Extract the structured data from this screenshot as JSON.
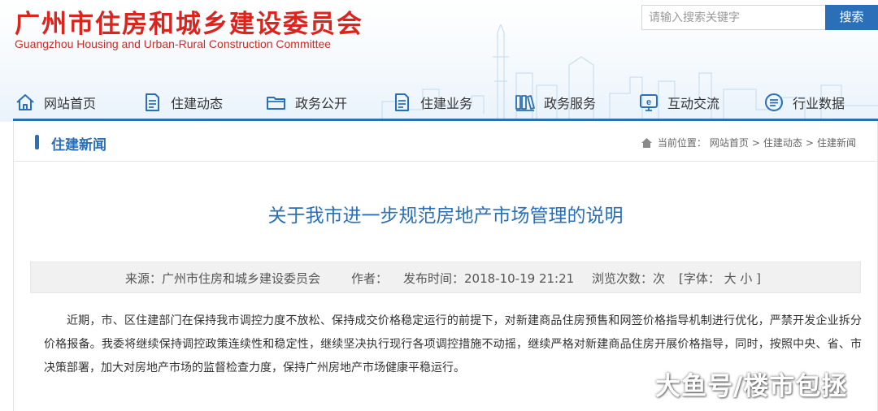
{
  "header": {
    "title": "广州市住房和城乡建设委员会",
    "subtitle": "Guangzhou Housing and Urban-Rural Construction Committee"
  },
  "search": {
    "placeholder": "请输入搜索关键字",
    "button_label": "搜索"
  },
  "nav": {
    "items": [
      {
        "label": "网站首页",
        "icon": "home-icon"
      },
      {
        "label": "住建动态",
        "icon": "document-icon"
      },
      {
        "label": "政务公开",
        "icon": "folder-icon"
      },
      {
        "label": "住建业务",
        "icon": "document-icon"
      },
      {
        "label": "政务服务",
        "icon": "books-icon"
      },
      {
        "label": "互动交流",
        "icon": "chat-screen-icon"
      },
      {
        "label": "行业数据",
        "icon": "list-circle-icon"
      }
    ]
  },
  "section": {
    "title": "住建新闻"
  },
  "breadcrumb": {
    "prefix": "当前位置：",
    "items": [
      "网站首页",
      "住建动态",
      "住建新闻"
    ],
    "separator": ">"
  },
  "article": {
    "title": "关于我市进一步规范房地产市场管理的说明",
    "meta": {
      "source": "来源：广州市住房和城乡建设委员会",
      "author": "作者：",
      "date": "发布时间：2018-10-19 21:21",
      "views": "浏览次数：次",
      "font_size": "[字体： 大  小 ]"
    },
    "body": "近期，市、区住建部门在保持我市调控力度不放松、保持成交价格稳定运行的前提下，对新建商品住房预售和网签价格指导机制进行优化，严禁开发企业拆分价格报备。我委将继续保持调控政策连续性和稳定性，继续坚决执行现行各项调控措施不动摇，继续严格对新建商品住房开展价格指导，同时，按照中央、省、市决策部署，加大对房地产市场的监督检查力度，保持广州房地产市场健康平稳运行。"
  },
  "watermark": "大鱼号/楼市包拯",
  "colors": {
    "brand_red": "#d9251d",
    "accent_blue": "#2a6fb8",
    "meta_bg": "#f1f1f1"
  }
}
